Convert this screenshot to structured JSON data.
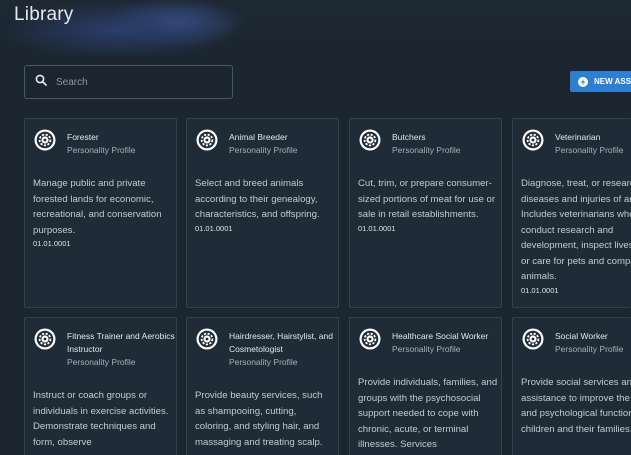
{
  "page": {
    "title": "Library"
  },
  "search": {
    "placeholder": "Search",
    "value": ""
  },
  "toolbar": {
    "new_button_label": "NEW ASS"
  },
  "colors": {
    "accent": "#2f7fd0",
    "background": "#1b2630",
    "card": "#1f2b36"
  },
  "cards": [
    {
      "name": "Forester",
      "subtitle": "Personality Profile",
      "description": "Manage public and private forested lands for economic, recreational, and conservation purposes.",
      "code": "01.01.0001",
      "icon": "gear-icon"
    },
    {
      "name": "Animal Breeder",
      "subtitle": "Personality Profile",
      "description": "Select and breed animals according to their genealogy, characteristics, and offspring.",
      "code": "01.01.0001",
      "icon": "gear-icon"
    },
    {
      "name": "Butchers",
      "subtitle": "Personality Profile",
      "description": "Cut, trim, or prepare consumer-sized portions of meat for use or sale in retail establishments.",
      "code": "01.01.0001",
      "icon": "gear-icon"
    },
    {
      "name": "Veterinarian",
      "subtitle": "Personality Profile",
      "description": "Diagnose, treat, or research diseases and injuries of animals. Includes veterinarians who conduct research and development, inspect livestock, or care for pets and companion animals.",
      "code": "01.01.0001",
      "icon": "gear-icon"
    },
    {
      "name": "Fitness Trainer and Aerobics Instructor",
      "subtitle": "Personality Profile",
      "description": "Instruct or coach groups or individuals in exercise activities. Demonstrate techniques and form, observe",
      "code": "",
      "icon": "gear-icon"
    },
    {
      "name": "Hairdresser, Hairstylist, and Cosmetologist",
      "subtitle": "Personality Profile",
      "description": "Provide beauty services, such as shampooing, cutting, coloring, and styling hair, and massaging and treating scalp.",
      "code": "",
      "icon": "gear-icon"
    },
    {
      "name": "Healthcare Social Worker",
      "subtitle": "Personality Profile",
      "description": "Provide individuals, families, and groups with the psychosocial support needed to cope with chronic, acute, or terminal illnesses. Services",
      "code": "",
      "icon": "gear-icon"
    },
    {
      "name": "Social Worker",
      "subtitle": "Personality Profile",
      "description": "Provide social services and assistance to improve the social and psychological functioning of children and their families.",
      "code": "",
      "icon": "gear-icon"
    }
  ]
}
